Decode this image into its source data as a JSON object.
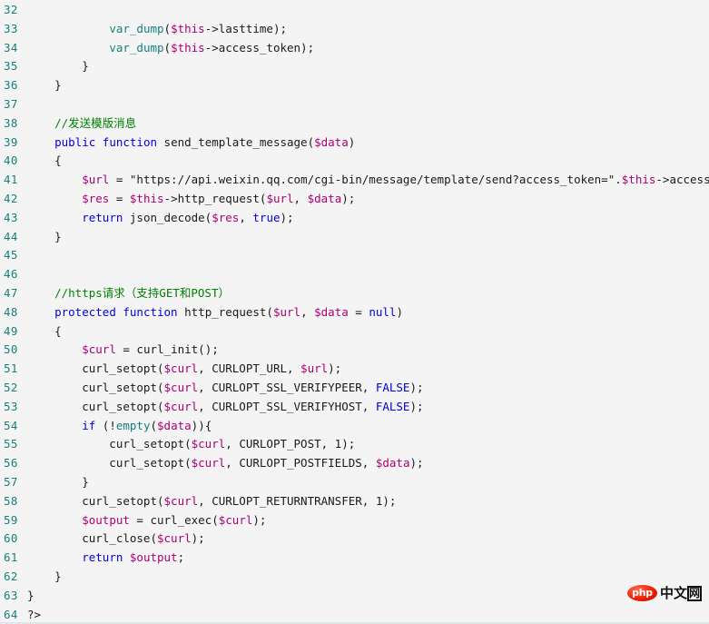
{
  "editor": {
    "language": "php",
    "background_color": "#f4f4f4",
    "first_line_number": 32,
    "last_line_number": 64,
    "colors": {
      "line_number": "#17807e",
      "keyword": "#0000dd",
      "variable": "#aa0077",
      "function": "#17807e",
      "comment": "#008000",
      "text": "#1a1a1a"
    }
  },
  "lines": [
    {
      "number": "32",
      "tokens": []
    },
    {
      "number": "33",
      "tokens": [
        {
          "t": "plain",
          "s": "            "
        },
        {
          "t": "fn",
          "s": "var_dump"
        },
        {
          "t": "plain",
          "s": "("
        },
        {
          "t": "var",
          "s": "$this"
        },
        {
          "t": "plain",
          "s": "->lasttime);"
        }
      ]
    },
    {
      "number": "34",
      "tokens": [
        {
          "t": "plain",
          "s": "            "
        },
        {
          "t": "fn",
          "s": "var_dump"
        },
        {
          "t": "plain",
          "s": "("
        },
        {
          "t": "var",
          "s": "$this"
        },
        {
          "t": "plain",
          "s": "->access_token);"
        }
      ]
    },
    {
      "number": "35",
      "tokens": [
        {
          "t": "plain",
          "s": "        }"
        }
      ]
    },
    {
      "number": "36",
      "tokens": [
        {
          "t": "plain",
          "s": "    }"
        }
      ]
    },
    {
      "number": "37",
      "tokens": []
    },
    {
      "number": "38",
      "tokens": [
        {
          "t": "plain",
          "s": "    "
        },
        {
          "t": "comment",
          "s": "//发送模版消息"
        }
      ]
    },
    {
      "number": "39",
      "tokens": [
        {
          "t": "plain",
          "s": "    "
        },
        {
          "t": "kw",
          "s": "public"
        },
        {
          "t": "plain",
          "s": " "
        },
        {
          "t": "kw",
          "s": "function"
        },
        {
          "t": "plain",
          "s": " send_template_message("
        },
        {
          "t": "var",
          "s": "$data"
        },
        {
          "t": "plain",
          "s": ")"
        }
      ]
    },
    {
      "number": "40",
      "tokens": [
        {
          "t": "plain",
          "s": "    {"
        }
      ]
    },
    {
      "number": "41",
      "tokens": [
        {
          "t": "plain",
          "s": "        "
        },
        {
          "t": "var",
          "s": "$url"
        },
        {
          "t": "plain",
          "s": " = "
        },
        {
          "t": "str",
          "s": "\"https://api.weixin.qq.com/cgi-bin/message/template/send?access_token=\""
        },
        {
          "t": "plain",
          "s": "."
        },
        {
          "t": "var",
          "s": "$this"
        },
        {
          "t": "plain",
          "s": "->access_token;"
        }
      ]
    },
    {
      "number": "42",
      "tokens": [
        {
          "t": "plain",
          "s": "        "
        },
        {
          "t": "var",
          "s": "$res"
        },
        {
          "t": "plain",
          "s": " = "
        },
        {
          "t": "var",
          "s": "$this"
        },
        {
          "t": "plain",
          "s": "->http_request("
        },
        {
          "t": "var",
          "s": "$url"
        },
        {
          "t": "plain",
          "s": ", "
        },
        {
          "t": "var",
          "s": "$data"
        },
        {
          "t": "plain",
          "s": ");"
        }
      ]
    },
    {
      "number": "43",
      "tokens": [
        {
          "t": "plain",
          "s": "        "
        },
        {
          "t": "kw",
          "s": "return"
        },
        {
          "t": "plain",
          "s": " json_decode("
        },
        {
          "t": "var",
          "s": "$res"
        },
        {
          "t": "plain",
          "s": ", "
        },
        {
          "t": "const",
          "s": "true"
        },
        {
          "t": "plain",
          "s": ");"
        }
      ]
    },
    {
      "number": "44",
      "tokens": [
        {
          "t": "plain",
          "s": "    }"
        }
      ]
    },
    {
      "number": "45",
      "tokens": []
    },
    {
      "number": "46",
      "tokens": []
    },
    {
      "number": "47",
      "tokens": [
        {
          "t": "plain",
          "s": "    "
        },
        {
          "t": "comment",
          "s": "//https请求（支持GET和POST）"
        }
      ]
    },
    {
      "number": "48",
      "tokens": [
        {
          "t": "plain",
          "s": "    "
        },
        {
          "t": "kw",
          "s": "protected"
        },
        {
          "t": "plain",
          "s": " "
        },
        {
          "t": "kw",
          "s": "function"
        },
        {
          "t": "plain",
          "s": " http_request("
        },
        {
          "t": "var",
          "s": "$url"
        },
        {
          "t": "plain",
          "s": ", "
        },
        {
          "t": "var",
          "s": "$data"
        },
        {
          "t": "plain",
          "s": " = "
        },
        {
          "t": "const",
          "s": "null"
        },
        {
          "t": "plain",
          "s": ")"
        }
      ]
    },
    {
      "number": "49",
      "tokens": [
        {
          "t": "plain",
          "s": "    {"
        }
      ]
    },
    {
      "number": "50",
      "tokens": [
        {
          "t": "plain",
          "s": "        "
        },
        {
          "t": "var",
          "s": "$curl"
        },
        {
          "t": "plain",
          "s": " = curl_init();"
        }
      ]
    },
    {
      "number": "51",
      "tokens": [
        {
          "t": "plain",
          "s": "        curl_setopt("
        },
        {
          "t": "var",
          "s": "$curl"
        },
        {
          "t": "plain",
          "s": ", CURLOPT_URL, "
        },
        {
          "t": "var",
          "s": "$url"
        },
        {
          "t": "plain",
          "s": ");"
        }
      ]
    },
    {
      "number": "52",
      "tokens": [
        {
          "t": "plain",
          "s": "        curl_setopt("
        },
        {
          "t": "var",
          "s": "$curl"
        },
        {
          "t": "plain",
          "s": ", CURLOPT_SSL_VERIFYPEER, "
        },
        {
          "t": "const",
          "s": "FALSE"
        },
        {
          "t": "plain",
          "s": ");"
        }
      ]
    },
    {
      "number": "53",
      "tokens": [
        {
          "t": "plain",
          "s": "        curl_setopt("
        },
        {
          "t": "var",
          "s": "$curl"
        },
        {
          "t": "plain",
          "s": ", CURLOPT_SSL_VERIFYHOST, "
        },
        {
          "t": "const",
          "s": "FALSE"
        },
        {
          "t": "plain",
          "s": ");"
        }
      ]
    },
    {
      "number": "54",
      "tokens": [
        {
          "t": "plain",
          "s": "        "
        },
        {
          "t": "kw",
          "s": "if"
        },
        {
          "t": "plain",
          "s": " (!"
        },
        {
          "t": "fn",
          "s": "empty"
        },
        {
          "t": "plain",
          "s": "("
        },
        {
          "t": "var",
          "s": "$data"
        },
        {
          "t": "plain",
          "s": ")){"
        }
      ]
    },
    {
      "number": "55",
      "tokens": [
        {
          "t": "plain",
          "s": "            curl_setopt("
        },
        {
          "t": "var",
          "s": "$curl"
        },
        {
          "t": "plain",
          "s": ", CURLOPT_POST, 1);"
        }
      ]
    },
    {
      "number": "56",
      "tokens": [
        {
          "t": "plain",
          "s": "            curl_setopt("
        },
        {
          "t": "var",
          "s": "$curl"
        },
        {
          "t": "plain",
          "s": ", CURLOPT_POSTFIELDS, "
        },
        {
          "t": "var",
          "s": "$data"
        },
        {
          "t": "plain",
          "s": ");"
        }
      ]
    },
    {
      "number": "57",
      "tokens": [
        {
          "t": "plain",
          "s": "        }"
        }
      ]
    },
    {
      "number": "58",
      "tokens": [
        {
          "t": "plain",
          "s": "        curl_setopt("
        },
        {
          "t": "var",
          "s": "$curl"
        },
        {
          "t": "plain",
          "s": ", CURLOPT_RETURNTRANSFER, 1);"
        }
      ]
    },
    {
      "number": "59",
      "tokens": [
        {
          "t": "plain",
          "s": "        "
        },
        {
          "t": "var",
          "s": "$output"
        },
        {
          "t": "plain",
          "s": " = curl_exec("
        },
        {
          "t": "var",
          "s": "$curl"
        },
        {
          "t": "plain",
          "s": ");"
        }
      ]
    },
    {
      "number": "60",
      "tokens": [
        {
          "t": "plain",
          "s": "        curl_close("
        },
        {
          "t": "var",
          "s": "$curl"
        },
        {
          "t": "plain",
          "s": ");"
        }
      ]
    },
    {
      "number": "61",
      "tokens": [
        {
          "t": "plain",
          "s": "        "
        },
        {
          "t": "kw",
          "s": "return"
        },
        {
          "t": "plain",
          "s": " "
        },
        {
          "t": "var",
          "s": "$output"
        },
        {
          "t": "plain",
          "s": ";"
        }
      ]
    },
    {
      "number": "62",
      "tokens": [
        {
          "t": "plain",
          "s": "    }"
        }
      ]
    },
    {
      "number": "63",
      "tokens": [
        {
          "t": "plain",
          "s": "}"
        }
      ]
    },
    {
      "number": "64",
      "tokens": [
        {
          "t": "plain",
          "s": "?>"
        }
      ]
    }
  ],
  "watermark": {
    "badge_text": "php",
    "text_primary": "中文",
    "text_boxed": "网",
    "badge_color": "#ee2200"
  }
}
